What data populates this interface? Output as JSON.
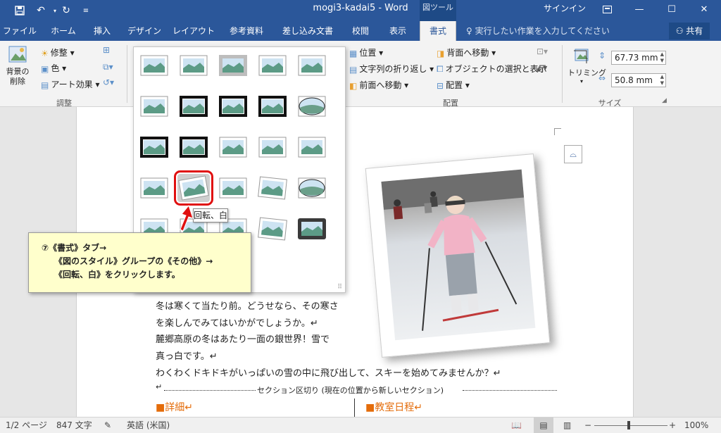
{
  "window": {
    "title": "mogi3-kadai5 - Word",
    "context_tab_group": "図ツール",
    "signin": "サインイン"
  },
  "tabs": [
    "ファイル",
    "ホーム",
    "挿入",
    "デザイン",
    "レイアウト",
    "参考資料",
    "差し込み文書",
    "校閲",
    "表示",
    "書式"
  ],
  "active_tab": "書式",
  "tell_me": "実行したい作業を入力してください",
  "share": "共有",
  "ribbon": {
    "adjust": {
      "remove_bg": [
        "背景の",
        "削除"
      ],
      "corrections": "修整",
      "color": "色",
      "art_effects": "アート効果",
      "group": "調整"
    },
    "arrange": {
      "position": "位置",
      "wrap_text": "文字列の折り返し",
      "bring_forward": "前面へ移動",
      "send_backward": "背面へ移動",
      "selection_pane": "オブジェクトの選択と表示",
      "align": "配置",
      "group": "配置"
    },
    "size": {
      "crop": "トリミング",
      "height": "67.73 mm",
      "width": "50.8 mm",
      "group": "サイズ"
    }
  },
  "gallery": {
    "tooltip": "回転、白",
    "highlighted_index": 16
  },
  "callout": {
    "line1": "⑦《書式》タブ→",
    "line2": "《図のスタイル》グループの《その他》→",
    "line3": "《回転、白》をクリックします。"
  },
  "document": {
    "lines": [
      "冬は寒くて当たり前。どうせなら、その寒さ",
      "を楽しんでみてはいかがでしょうか。↵",
      "麓郷高原の冬はあたり一面の銀世界！雪で",
      "真っ白です。↵",
      "わくわくドキドキがいっぱいの雪の中に飛び出して、スキーを始めてみませんか？↵"
    ],
    "comma_fragment": "、",
    "section_break": "セクション区切り (現在の位置から新しいセクション)",
    "heading_left": "■詳細↵",
    "heading_right": "■教室日程↵"
  },
  "statusbar": {
    "page": "1/2 ページ",
    "words": "847 文字",
    "language": "英語 (米国)",
    "zoom": "100%"
  },
  "colors": {
    "word_blue": "#2b579a",
    "highlight_red": "#e01010",
    "callout_bg": "#ffffcc",
    "heading_orange": "#e46c0a"
  }
}
